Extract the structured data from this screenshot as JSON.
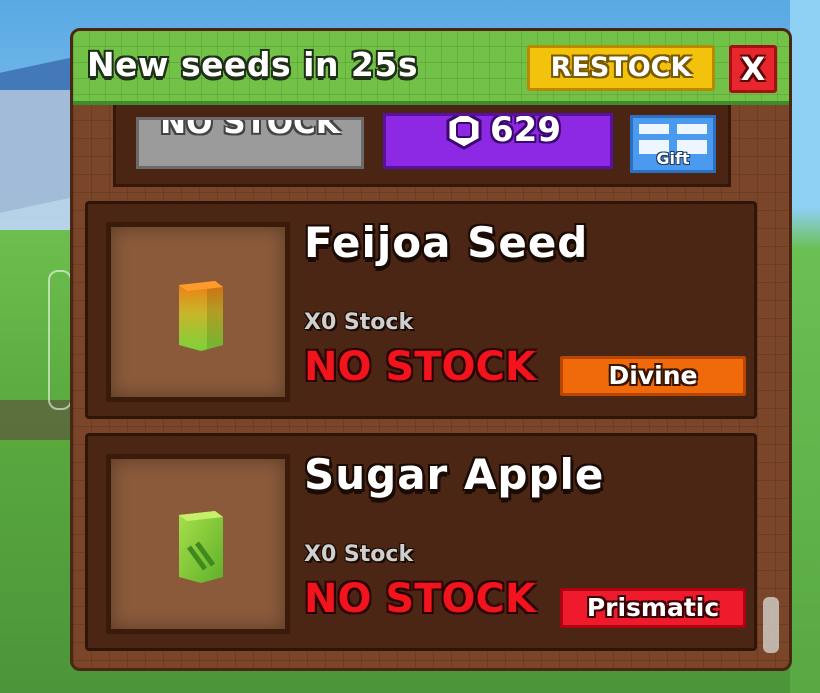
{
  "shop": {
    "timer_text": "New seeds in 25s",
    "restock_label": "RESTOCK",
    "close_label": "X",
    "top_row": {
      "status_label": "NO STOCK",
      "price": "629",
      "gift_label": "Gift"
    },
    "items": [
      {
        "name": "Feijoa Seed",
        "stock_count": "X0 Stock",
        "stock_status": "NO STOCK",
        "rarity": "Divine",
        "rarity_color": "#f06a0c",
        "icon": "feijoa-seed-icon"
      },
      {
        "name": "Sugar Apple",
        "stock_count": "X0 Stock",
        "stock_status": "NO STOCK",
        "rarity": "Prismatic",
        "rarity_color": "#ef1a2c",
        "icon": "sugar-apple-seed-icon"
      }
    ]
  },
  "colors": {
    "header_green": "#72c247",
    "panel_brown": "#7a4528",
    "card_dark": "#4c2614",
    "restock_yellow": "#f3c20c",
    "close_red": "#e7272d",
    "price_purple": "#8d28e3",
    "gift_blue": "#4a9bf0",
    "no_stock_red": "#f2141c"
  }
}
